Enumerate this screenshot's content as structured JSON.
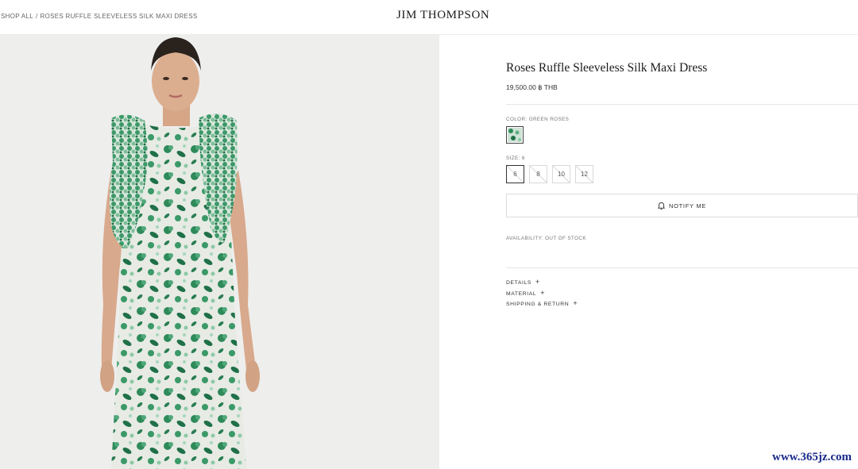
{
  "header": {
    "breadcrumb": [
      {
        "label": "SHOP ALL"
      },
      {
        "label": "ROSES RUFFLE SLEEVELESS SILK MAXI DRESS"
      }
    ],
    "breadcrumb_separator": "/",
    "brand": "JIM THOMPSON"
  },
  "product": {
    "title": "Roses Ruffle Sleeveless Silk Maxi Dress",
    "price": "19,500.00 ฿ THB",
    "color_label": "COLOR: GREEN ROSES",
    "size_label": "SIZE: 6",
    "sizes": [
      {
        "label": "6",
        "selected": true,
        "available": false
      },
      {
        "label": "8",
        "selected": false,
        "available": false
      },
      {
        "label": "10",
        "selected": false,
        "available": false
      },
      {
        "label": "12",
        "selected": false,
        "available": false
      }
    ],
    "notify_label": "NOTIFY ME",
    "availability": "AVAILABILITY: OUT OF STOCK",
    "accordion": [
      {
        "label": "DETAILS",
        "icon": "plus-icon"
      },
      {
        "label": "MATERIAL",
        "icon": "plus-icon"
      },
      {
        "label": "SHIPPING & RETURN",
        "icon": "plus-icon"
      }
    ]
  },
  "colors": {
    "dress_green": "#2f8a5a",
    "dress_base": "#e8ece6",
    "background_image": "#eeeeed"
  },
  "watermark": "www.365jz.com"
}
